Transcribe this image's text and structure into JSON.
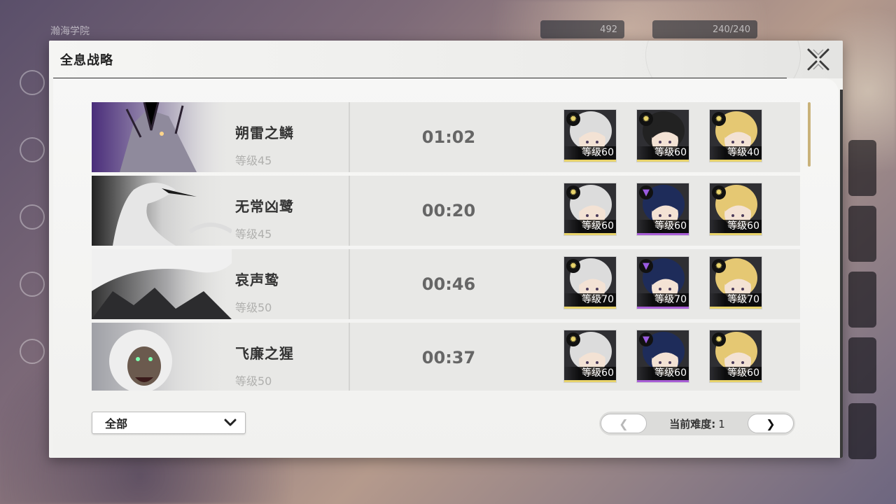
{
  "background": {
    "menu_label": "瀚海学院",
    "currency_1": "492",
    "currency_2": "240/240"
  },
  "dialog": {
    "title": "全息战略"
  },
  "rows": [
    {
      "boss_name": "朔雷之鳞",
      "boss_level": "等级45",
      "clear_time": "01:02",
      "team": [
        {
          "level": "等级60",
          "element": "spectro",
          "rarity_color": "#e8d36a"
        },
        {
          "level": "等级60",
          "element": "spectro",
          "rarity_color": "#e8d36a"
        },
        {
          "level": "等级40",
          "element": "spectro",
          "rarity_color": "#e8d36a"
        }
      ]
    },
    {
      "boss_name": "无常凶鹭",
      "boss_level": "等级45",
      "clear_time": "00:20",
      "team": [
        {
          "level": "等级60",
          "element": "spectro",
          "rarity_color": "#e8d36a"
        },
        {
          "level": "等级60",
          "element": "havoc",
          "rarity_color": "#a85ed6"
        },
        {
          "level": "等级60",
          "element": "spectro",
          "rarity_color": "#e8d36a"
        }
      ]
    },
    {
      "boss_name": "哀声鸷",
      "boss_level": "等级50",
      "clear_time": "00:46",
      "team": [
        {
          "level": "等级70",
          "element": "spectro",
          "rarity_color": "#e8d36a"
        },
        {
          "level": "等级70",
          "element": "havoc",
          "rarity_color": "#a85ed6"
        },
        {
          "level": "等级70",
          "element": "spectro",
          "rarity_color": "#e8d36a"
        }
      ]
    },
    {
      "boss_name": "飞廉之猩",
      "boss_level": "等级50",
      "clear_time": "00:37",
      "team": [
        {
          "level": "等级60",
          "element": "spectro",
          "rarity_color": "#e8d36a"
        },
        {
          "level": "等级60",
          "element": "havoc",
          "rarity_color": "#a85ed6"
        },
        {
          "level": "等级60",
          "element": "spectro",
          "rarity_color": "#e8d36a"
        }
      ]
    }
  ],
  "filter": {
    "selected": "全部",
    "icon": "chevron-down-icon"
  },
  "pager": {
    "label": "当前难度:",
    "value": "1",
    "prev_icon": "chevron-left-icon",
    "next_icon": "chevron-right-icon",
    "prev_glyph": "❮",
    "next_glyph": "❯"
  },
  "colors": {
    "accent_gold": "#c9b27a",
    "spectro_icon": "#e8d36a",
    "havoc_icon": "#9a5be0"
  }
}
